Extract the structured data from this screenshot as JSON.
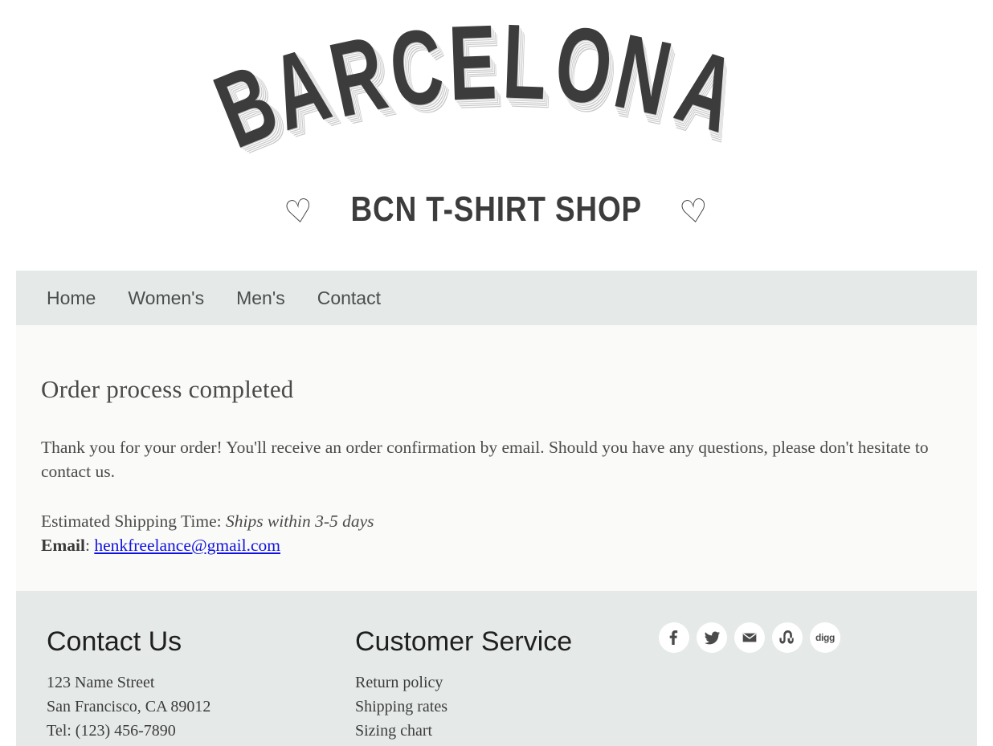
{
  "masthead": {
    "logo_text": "BARCELONA",
    "tagline": "BCN T-SHIRT SHOP",
    "heart_left": "♡",
    "heart_right": "♡",
    "logo_color": "#3c3c3c"
  },
  "nav": {
    "items": [
      {
        "label": "Home"
      },
      {
        "label": "Women's"
      },
      {
        "label": "Men's"
      },
      {
        "label": "Contact"
      }
    ]
  },
  "main": {
    "title": "Order process completed",
    "paragraph": "Thank you for your order! You'll receive an order confirmation by email. Should you have any questions, please don't hesitate to contact us.",
    "shipping_label": "Estimated Shipping Time:",
    "shipping_value": "Ships within 3-5 days",
    "email_label": "Email",
    "email_separator": ":",
    "email_value": "henkfreelance@gmail.com",
    "link_color": "#1212e0"
  },
  "footer": {
    "contact": {
      "heading": "Contact Us",
      "lines": [
        "123 Name Street",
        "San Francisco, CA 89012",
        "Tel: (123) 456-7890"
      ]
    },
    "service": {
      "heading": "Customer Service",
      "links": [
        "Return policy",
        "Shipping rates",
        "Sizing chart"
      ]
    },
    "social": [
      {
        "name": "facebook-icon",
        "label": "f"
      },
      {
        "name": "twitter-icon",
        "label": ""
      },
      {
        "name": "email-icon",
        "label": ""
      },
      {
        "name": "stumbleupon-icon",
        "label": ""
      },
      {
        "name": "digg-icon",
        "label": "digg"
      }
    ],
    "background": "#e5e9e8"
  }
}
